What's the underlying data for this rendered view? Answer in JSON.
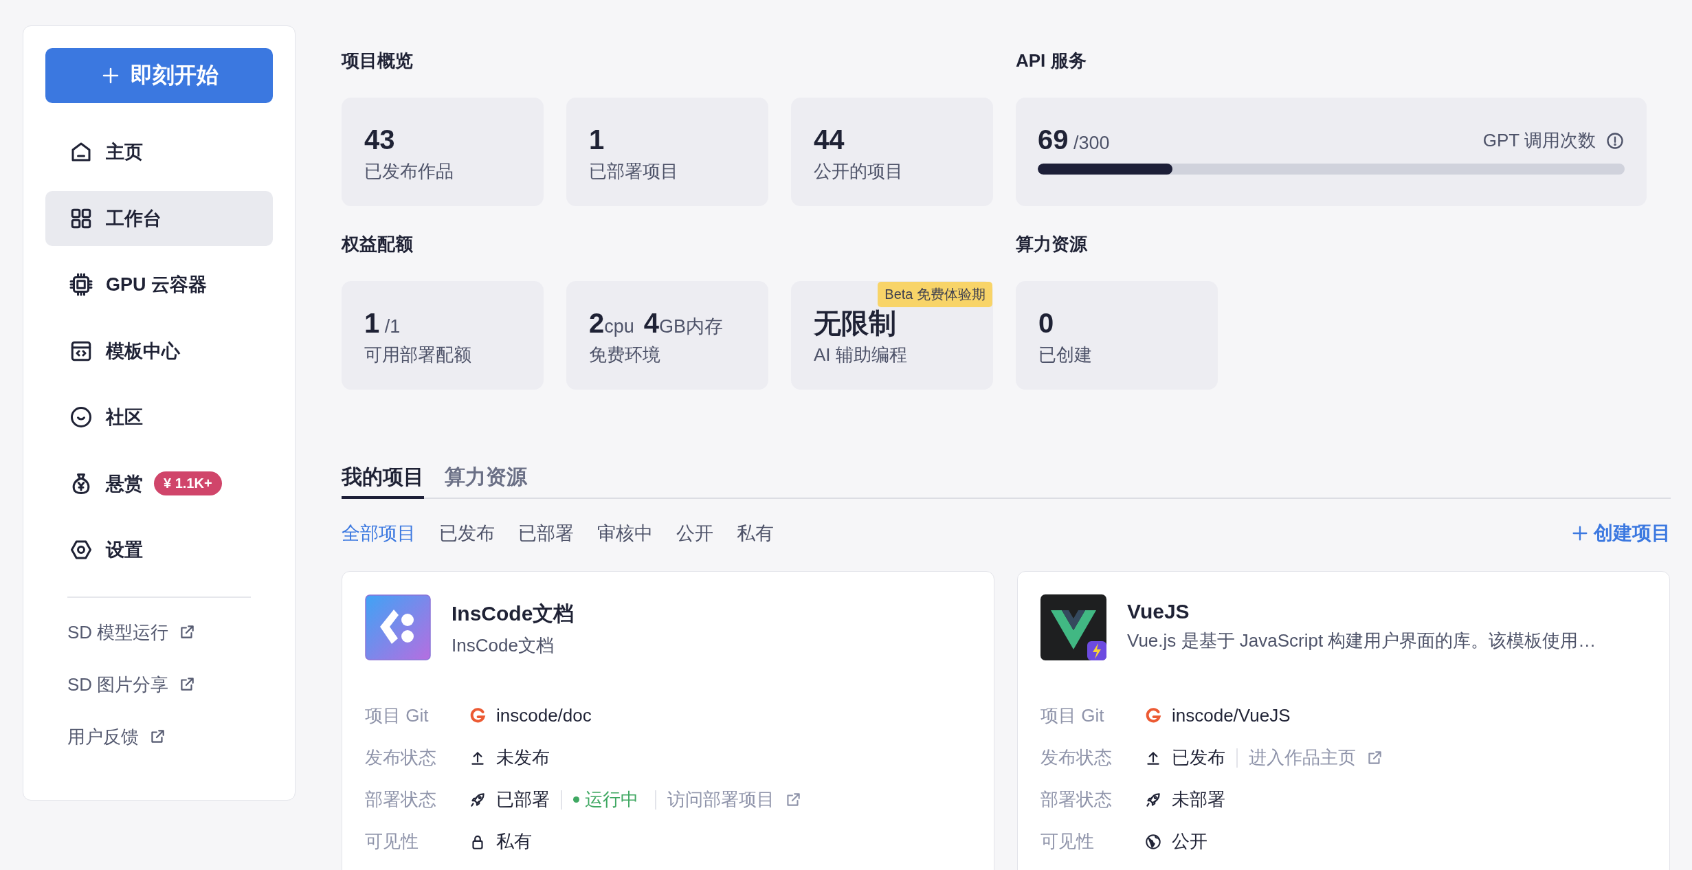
{
  "sidebar": {
    "start_button": {
      "label": "即刻开始"
    },
    "nav": [
      {
        "label": "主页",
        "selected": false
      },
      {
        "label": "工作台",
        "selected": true
      },
      {
        "label": "GPU 云容器",
        "selected": false
      },
      {
        "label": "模板中心",
        "selected": false
      },
      {
        "label": "社区",
        "selected": false
      },
      {
        "label": "悬赏",
        "selected": false,
        "badge": "¥ 1.1K+"
      },
      {
        "label": "设置",
        "selected": false
      }
    ],
    "links": [
      {
        "label": "SD 模型运行"
      },
      {
        "label": "SD 图片分享"
      },
      {
        "label": "用户反馈"
      }
    ]
  },
  "overview": {
    "title": "项目概览",
    "cards": [
      {
        "value": "43",
        "label": "已发布作品"
      },
      {
        "value": "1",
        "label": "已部署项目"
      },
      {
        "value": "44",
        "label": "公开的项目"
      }
    ]
  },
  "api": {
    "title": "API 服务",
    "value": "69",
    "total": "/300",
    "caption": "GPT 调用次数",
    "level": 0.23
  },
  "quota": {
    "title": "权益配额",
    "cards": [
      {
        "parts": [
          {
            "big": "1",
            "small": "/1"
          }
        ],
        "label": "可用部署配额"
      },
      {
        "parts": [
          {
            "big": "2",
            "small": "cpu"
          },
          {
            "big": "4",
            "small": "GB内存"
          }
        ],
        "label": "免费环境"
      },
      {
        "parts": [
          {
            "big": "无限制"
          }
        ],
        "label": "AI 辅助编程",
        "badge": "Beta 免费体验期"
      }
    ]
  },
  "compute": {
    "title": "算力资源",
    "cards": [
      {
        "value": "0",
        "label": "已创建"
      }
    ]
  },
  "tabs": [
    {
      "label": "我的项目",
      "selected": true
    },
    {
      "label": "算力资源",
      "selected": false
    }
  ],
  "filters": [
    {
      "label": "全部项目",
      "selected": true
    },
    {
      "label": "已发布",
      "selected": false
    },
    {
      "label": "已部署",
      "selected": false
    },
    {
      "label": "审核中",
      "selected": false
    },
    {
      "label": "公开",
      "selected": false
    },
    {
      "label": "私有",
      "selected": false
    }
  ],
  "create_button": {
    "label": "创建项目"
  },
  "projects": [
    {
      "kind": "inscode",
      "name": "InsCode文档",
      "description": "InsCode文档",
      "git_label": "项目 Git",
      "git": "inscode/doc",
      "publish_label": "发布状态",
      "publish_status": "未发布",
      "deploy_label": "部署状态",
      "deploy_status": "已部署",
      "running": "运行中",
      "deploy_link": "访问部署项目",
      "visibility_label": "可见性",
      "visibility": "私有",
      "public": false
    },
    {
      "kind": "vue",
      "name": "VueJS",
      "description": "Vue.js 是基于 JavaScript 构建用户界面的库。该模板使用…",
      "git_label": "项目 Git",
      "git": "inscode/VueJS",
      "publish_label": "发布状态",
      "publish_status": "已发布",
      "publish_link": "进入作品主页",
      "deploy_label": "部署状态",
      "deploy_status": "未部署",
      "visibility_label": "可见性",
      "visibility": "公开",
      "public": true
    }
  ]
}
